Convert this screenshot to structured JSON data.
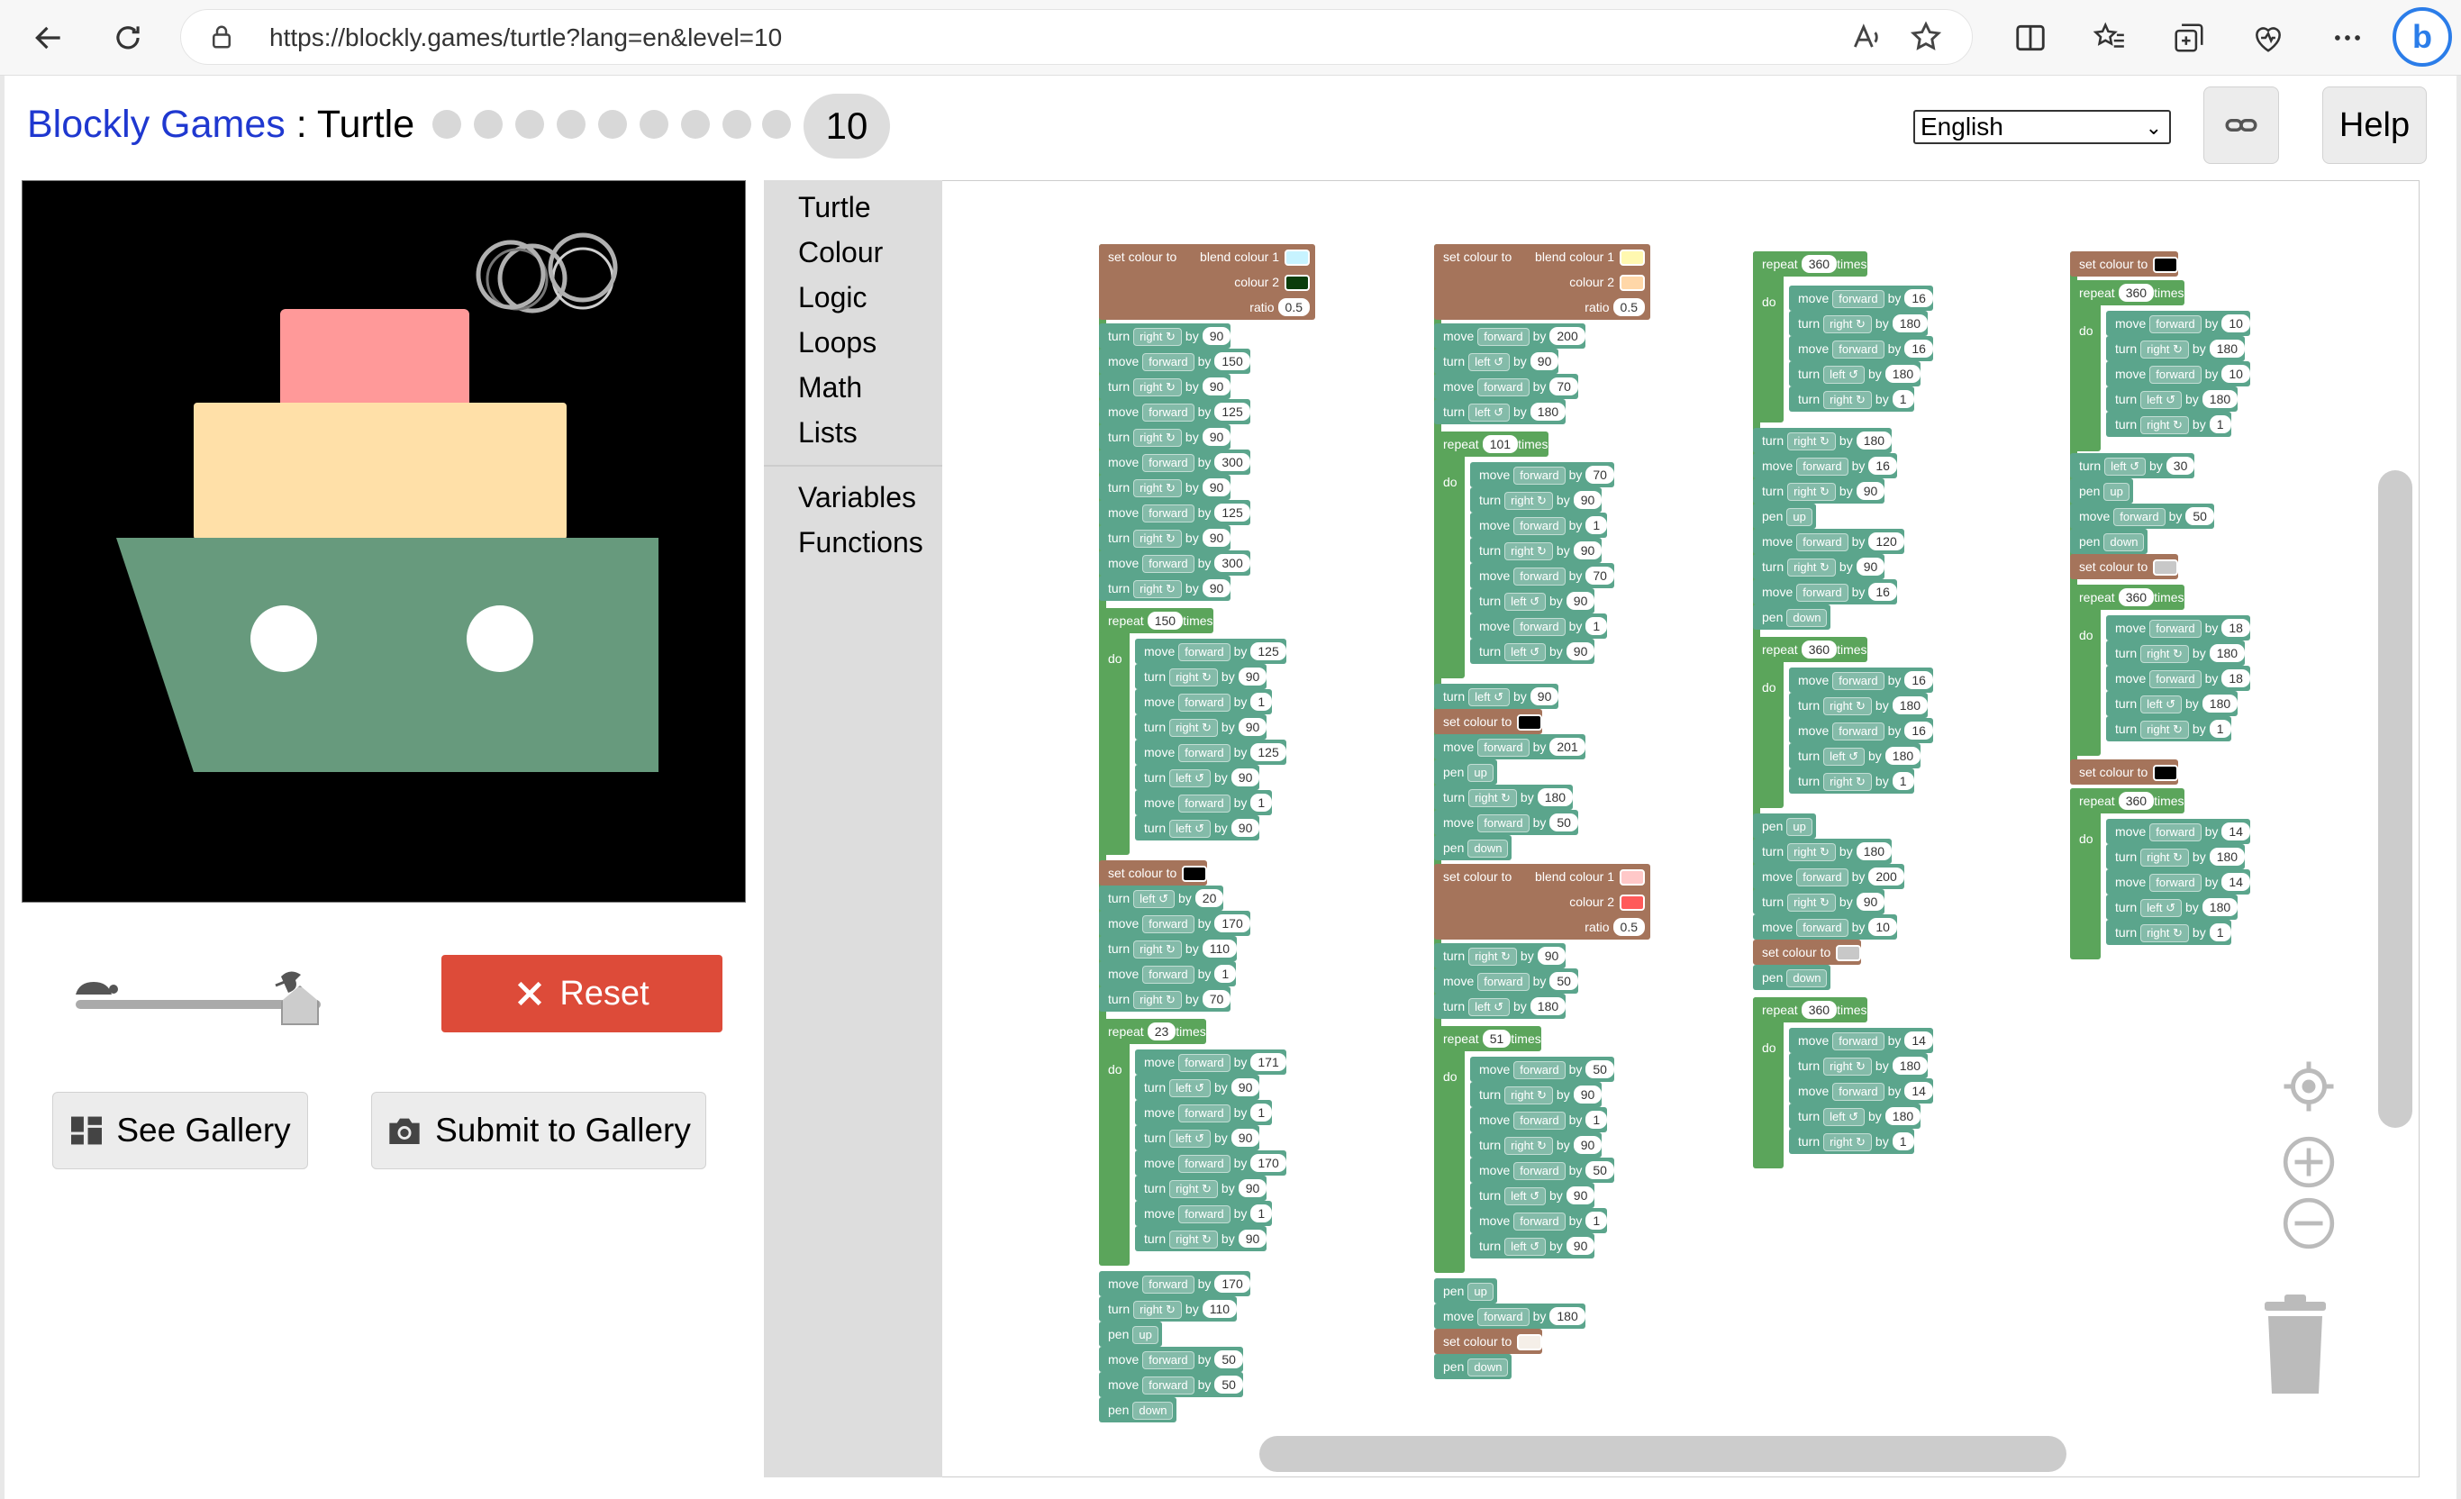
{
  "browser": {
    "url": "https://blockly.games/turtle?lang=en&level=10",
    "bing_label": "b"
  },
  "header": {
    "app_name": "Blockly Games",
    "separator": " : ",
    "page_name": "Turtle",
    "level_count": 9,
    "current_level": "10",
    "language": "English",
    "help_label": "Help"
  },
  "controls": {
    "reset_label": "Reset",
    "see_gallery_label": "See Gallery",
    "submit_gallery_label": "Submit to Gallery"
  },
  "toolbox": {
    "categories": [
      "Turtle",
      "Colour",
      "Logic",
      "Loops",
      "Math",
      "Lists"
    ],
    "categories2": [
      "Variables",
      "Functions"
    ]
  },
  "blocks": {
    "set_colour": "set colour to",
    "blend1": "blend colour 1",
    "colour2": "colour 2",
    "ratio": "ratio",
    "ratio_val": "0.5",
    "turn": "turn",
    "move": "move",
    "by": "by",
    "repeat": "repeat",
    "times": "times",
    "do": "do",
    "pen": "pen",
    "right": "right ↻",
    "left": "left ↺",
    "forward": "forward",
    "up": "up",
    "down": "down"
  },
  "colours": {
    "canvas_bg": "#000000",
    "boat_hull": "#679a7d",
    "boat_cabin": "#ffe0a8",
    "boat_top": "#ff9999",
    "portholes": "#ffffff",
    "smoke": "#b0b0b0",
    "reset_red": "#dd4b39",
    "title_blue": "#1f38d0",
    "swatch_lightblue": "#c7f3ff",
    "swatch_darkgreen": "#0b3d0b",
    "swatch_lightyellow": "#fff8b0",
    "swatch_peach": "#ffd7a8",
    "swatch_pink": "#ffc8c8",
    "swatch_red": "#ff5a5a",
    "swatch_black": "#000000",
    "swatch_gray": "#c8c8c8",
    "swatch_offwhite": "#f5efe8"
  }
}
